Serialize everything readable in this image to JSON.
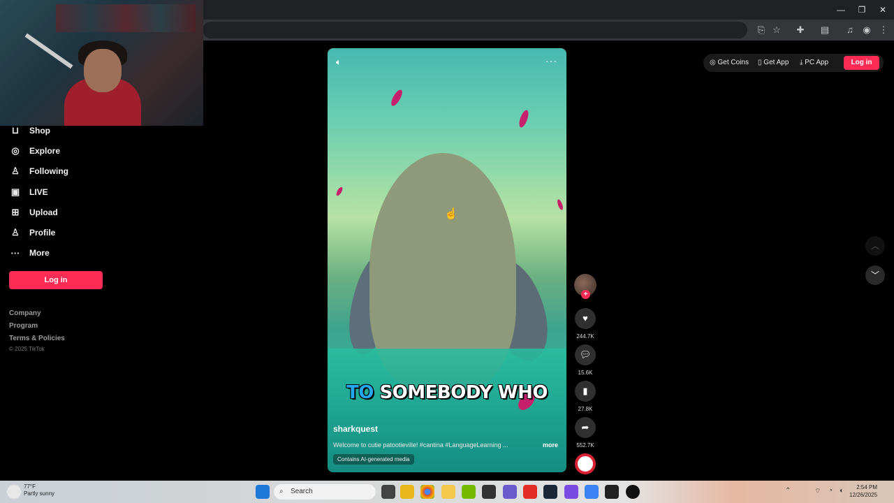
{
  "browser": {
    "window_controls": {
      "minimize": "—",
      "restore": "❐",
      "close": "✕"
    }
  },
  "sidebar": {
    "items": [
      {
        "label": "Shop",
        "icon": "shop-bag-icon",
        "glyph": "🛍"
      },
      {
        "label": "Explore",
        "icon": "compass-icon",
        "glyph": "⌖"
      },
      {
        "label": "Following",
        "icon": "following-user-icon",
        "glyph": "☍"
      },
      {
        "label": "LIVE",
        "icon": "live-tv-icon",
        "glyph": "▭"
      },
      {
        "label": "Upload",
        "icon": "upload-plus-icon",
        "glyph": "⊞"
      },
      {
        "label": "Profile",
        "icon": "profile-user-icon",
        "glyph": "♙"
      },
      {
        "label": "More",
        "icon": "more-dots-icon",
        "glyph": "···"
      }
    ],
    "login_label": "Log in",
    "footer": [
      "Company",
      "Program",
      "Terms & Policies"
    ],
    "copyright": "© 2025 TikTok"
  },
  "video": {
    "caption_highlight": "TO",
    "caption_rest": "SOMEBODY WHO",
    "username": "sharkquest",
    "description": "Welcome to cutie patootieville! #cantina #LanguageLearning ...",
    "more_label": "more",
    "ai_badge": "Contains AI-generated media"
  },
  "actions": {
    "like_count": "244.7K",
    "comment_count": "15.6K",
    "save_count": "27.8K",
    "share_count": "552.7K"
  },
  "header": {
    "get_coins": "Get Coins",
    "get_app": "Get App",
    "pc_app": "PC App",
    "login": "Log in"
  },
  "taskbar": {
    "search_placeholder": "Search",
    "weather_temp": "77°F",
    "weather_desc": "Partly sunny",
    "time": "2:54 PM",
    "date": "12/26/2025"
  },
  "colors": {
    "brand": "#fe2c55",
    "background": "#000000",
    "caption_highlight": "#22a7f0"
  }
}
